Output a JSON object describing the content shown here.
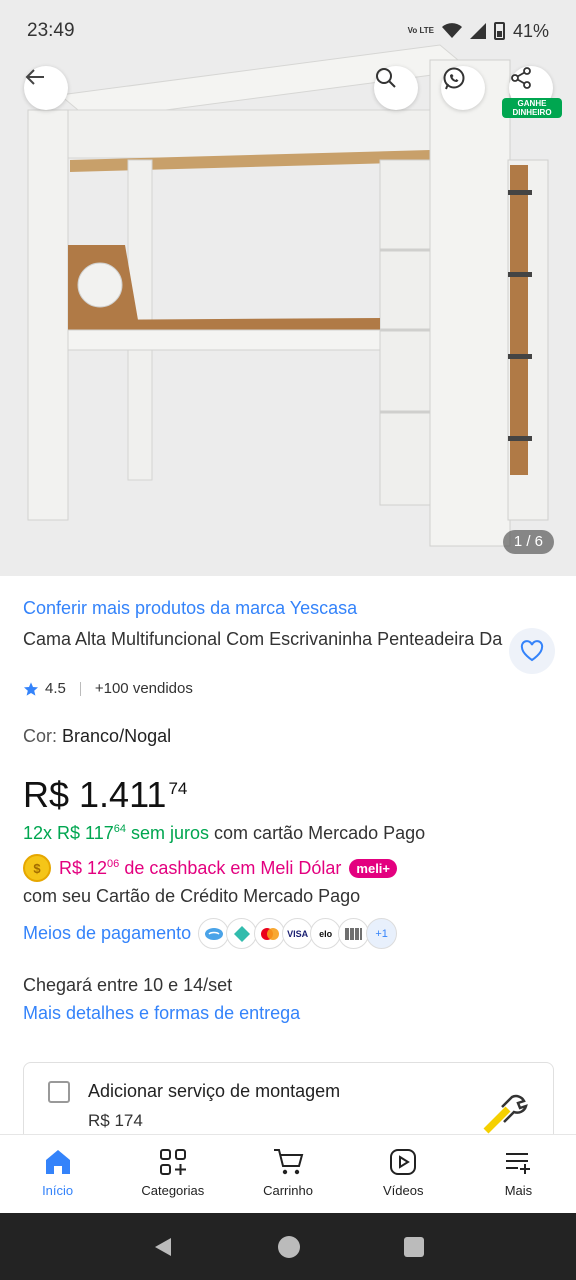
{
  "status_bar": {
    "time": "23:49",
    "battery": "41%",
    "network": "Vo LTE"
  },
  "gallery": {
    "counter": "1 / 6",
    "earn_badge_line1": "GANHE",
    "earn_badge_line2": "DINHEIRO"
  },
  "product": {
    "brand_link": "Conferir mais produtos da marca Yescasa",
    "title": "Cama Alta Multifuncional Com Escrivaninha Penteadeira Da",
    "rating": "4.5",
    "sold": "+100 vendidos",
    "color_label": "Cor:",
    "color_value": "Branco/Nogal",
    "price_main": "R$ 1.411",
    "price_cents": "74",
    "installments_prefix": "12x R$ 117",
    "installments_cents": "64",
    "installments_interest": "sem juros",
    "installments_suffix": "com cartão Mercado Pago",
    "cashback_prefix": "R$ 12",
    "cashback_cents": "06",
    "cashback_text": "de cashback em Meli Dólar",
    "meli_badge": "meli+",
    "card_line": "com seu Cartão de Crédito Mercado Pago",
    "payment_link": "Meios de pagamento",
    "payment_more": "+1",
    "delivery_text": "Chegará entre 10 e 14/set",
    "delivery_link": "Mais detalhes e formas de entrega"
  },
  "assembly": {
    "title": "Adicionar serviço de montagem",
    "price": "R$ 174"
  },
  "bottom_nav": [
    {
      "label": "Início",
      "icon": "home-icon",
      "active": true
    },
    {
      "label": "Categorias",
      "icon": "categories-icon",
      "active": false
    },
    {
      "label": "Carrinho",
      "icon": "cart-icon",
      "active": false
    },
    {
      "label": "Vídeos",
      "icon": "video-icon",
      "active": false
    },
    {
      "label": "Mais",
      "icon": "menu-plus-icon",
      "active": false
    }
  ],
  "colors": {
    "link_blue": "#3483fa",
    "green": "#00a650",
    "magenta": "#e3007f"
  }
}
